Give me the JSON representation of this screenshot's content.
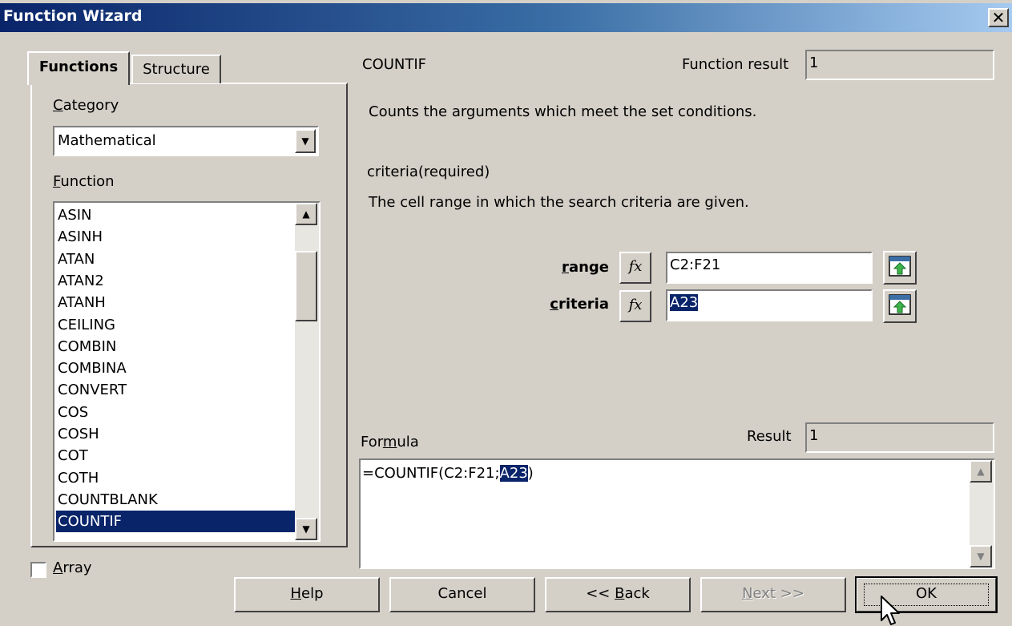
{
  "window": {
    "title": "Function Wizard",
    "close_glyph": "✕"
  },
  "tabs": [
    {
      "label": "Functions",
      "active": true
    },
    {
      "label": "Structure",
      "active": false
    }
  ],
  "category": {
    "label_underlined": "C",
    "label_rest": "ategory",
    "selected": "Mathematical"
  },
  "function_list": {
    "label_underlined": "F",
    "label_rest": "unction",
    "items": [
      "ASIN",
      "ASINH",
      "ATAN",
      "ATAN2",
      "ATANH",
      "CEILING",
      "COMBIN",
      "COMBINA",
      "CONVERT",
      "COS",
      "COSH",
      "COT",
      "COTH",
      "COUNTBLANK",
      "COUNTIF"
    ],
    "selected": "COUNTIF"
  },
  "function_info": {
    "name": "COUNTIF",
    "result_label": "Function result",
    "result_value": "1",
    "description": "Counts the arguments which meet the set conditions.",
    "arg_title": "criteria(required)",
    "arg_description": "The cell range in which the search criteria are given."
  },
  "arguments": [
    {
      "label_underlined": "r",
      "label_rest": "ange",
      "value": "C2:F21",
      "selected": false
    },
    {
      "label_underlined": "c",
      "label_rest": "riteria",
      "value": "A23",
      "selected": true
    }
  ],
  "fx_glyph": "fx",
  "formula": {
    "label_pre": "For",
    "label_underlined": "m",
    "label_post": "ula",
    "result_label": "Result",
    "result_value": "1",
    "text_before": "=COUNTIF(C2:F21;",
    "text_selected": "A23",
    "text_after": ")"
  },
  "array_checkbox": {
    "label_underlined": "A",
    "label_rest": "rray",
    "checked": false
  },
  "buttons": {
    "help": {
      "pre": "",
      "u": "H",
      "post": "elp"
    },
    "cancel": "Cancel",
    "back": {
      "pre": "<< ",
      "u": "B",
      "post": "ack"
    },
    "next": {
      "pre": "",
      "u": "N",
      "post": "ext >>"
    },
    "ok": "OK"
  },
  "colors": {
    "selection": "#0a246a",
    "face": "#d4d0c8"
  }
}
